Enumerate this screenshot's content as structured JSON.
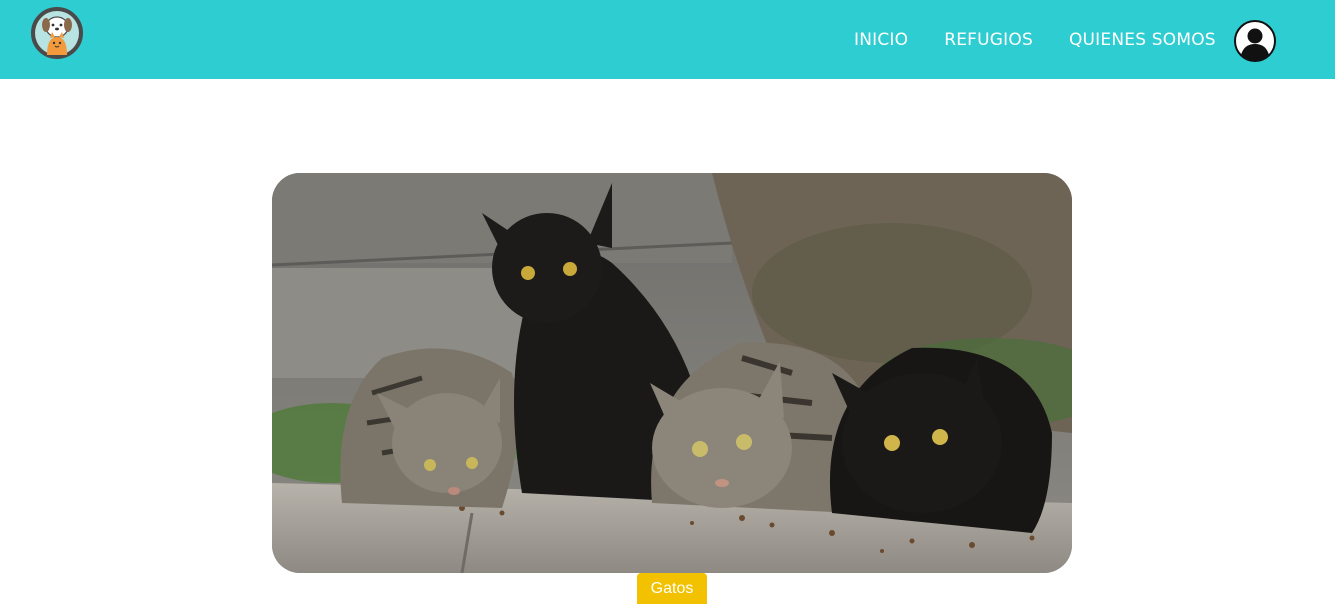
{
  "navbar": {
    "background": "#2ecdd2",
    "logo": {
      "icon": "pet-logo-icon"
    },
    "links": [
      "INICIO",
      "REFUGIOS",
      "QUIENES SOMOS"
    ],
    "profile": {
      "icon": "user-avatar-icon"
    }
  },
  "hero": {
    "image": "photo-of-five-cats-eating"
  },
  "badge": {
    "label": "Gatos",
    "color": "#f2c200"
  }
}
